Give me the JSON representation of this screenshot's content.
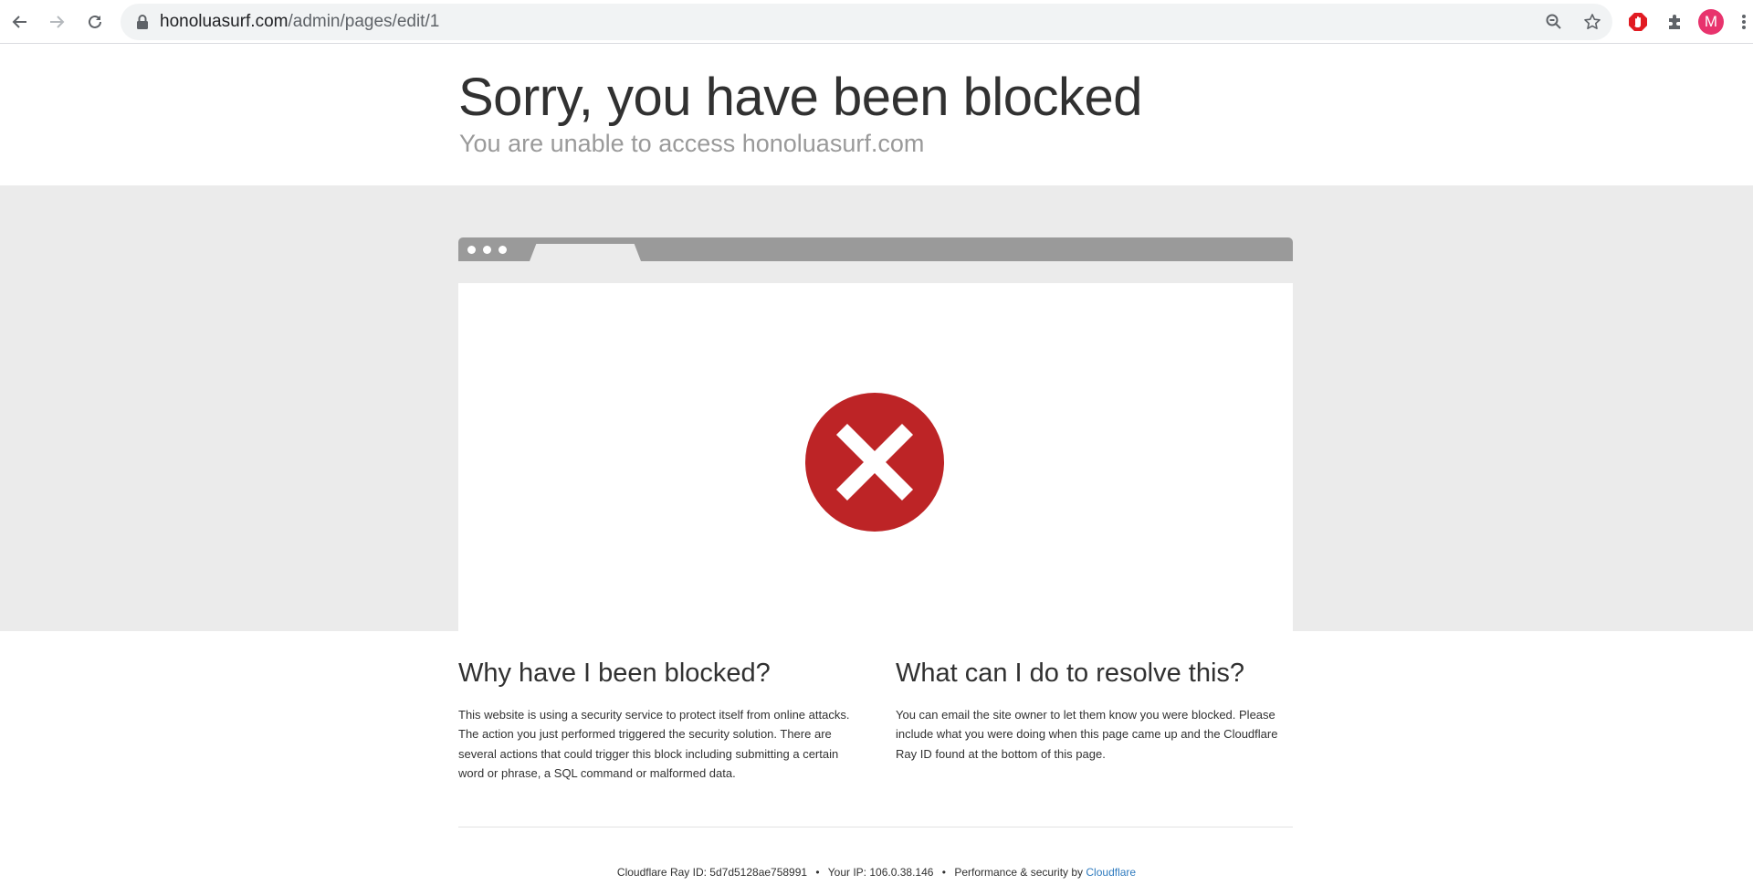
{
  "browser": {
    "url_domain": "honoluasurf.com",
    "url_path": "/admin/pages/edit/1",
    "profile_initial": "M"
  },
  "header": {
    "title": "Sorry, you have been blocked",
    "subtitle": "You are unable to access honoluasurf.com"
  },
  "why": {
    "title": "Why have I been blocked?",
    "text": "This website is using a security service to protect itself from online attacks. The action you just performed triggered the security solution. There are several actions that could trigger this block including submitting a certain word or phrase, a SQL command or malformed data."
  },
  "resolve": {
    "title": "What can I do to resolve this?",
    "text": "You can email the site owner to let them know you were blocked. Please include what you were doing when this page came up and the Cloudflare Ray ID found at the bottom of this page."
  },
  "footer": {
    "ray_label": "Cloudflare Ray ID:",
    "ray_id": "5d7d5128ae758991",
    "bullet": "•",
    "ip_label": "Your IP:",
    "ip": "106.0.38.146",
    "perf_label": "Performance & security by",
    "cloudflare_link": "Cloudflare"
  },
  "colors": {
    "error_red": "#bd2426",
    "band_gray": "#ebebeb",
    "bar_gray": "#9a9a9a",
    "link_blue": "#2f7bbf",
    "avatar_pink": "#e8336d"
  },
  "icons": [
    "back-arrow-icon",
    "forward-arrow-icon",
    "reload-icon",
    "lock-icon",
    "zoom-icon",
    "star-icon",
    "adblock-icon",
    "extensions-icon",
    "menu-dots-icon",
    "error-x-icon"
  ]
}
